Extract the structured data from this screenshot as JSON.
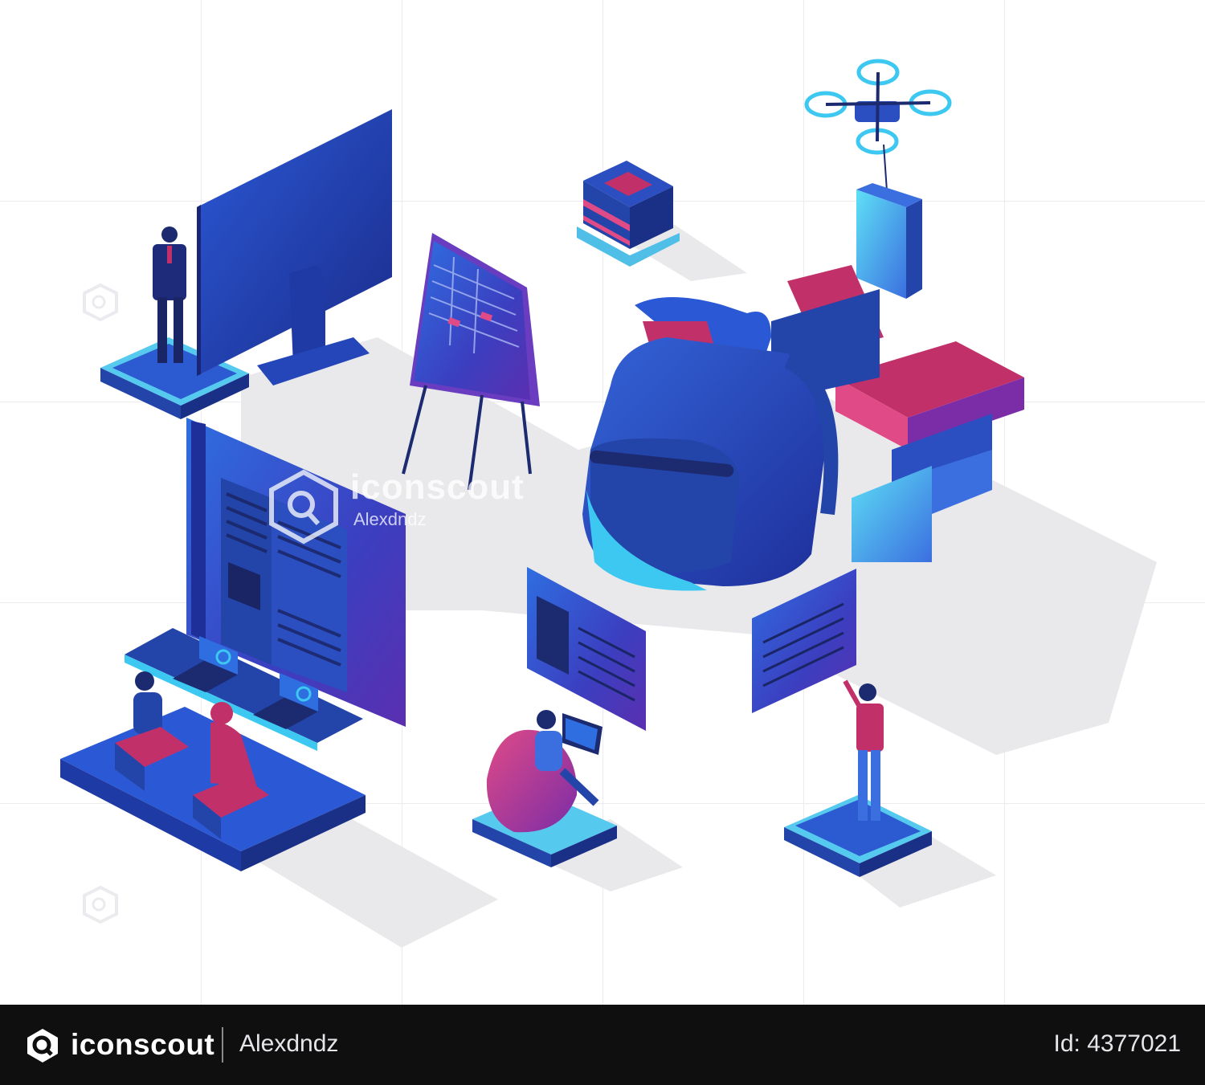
{
  "watermark": {
    "brand": "iconscout",
    "author": "Alexdndz"
  },
  "footer": {
    "brand": "iconscout",
    "author": "Alexdndz",
    "asset_id": "Id: 4377021"
  },
  "colors": {
    "primary_blue": "#2a4db8",
    "deep_blue": "#1c2f8f",
    "cyan": "#3cc8f0",
    "magenta": "#c2306a",
    "purple": "#6a35b8",
    "footer_bg": "#0f0f10"
  }
}
